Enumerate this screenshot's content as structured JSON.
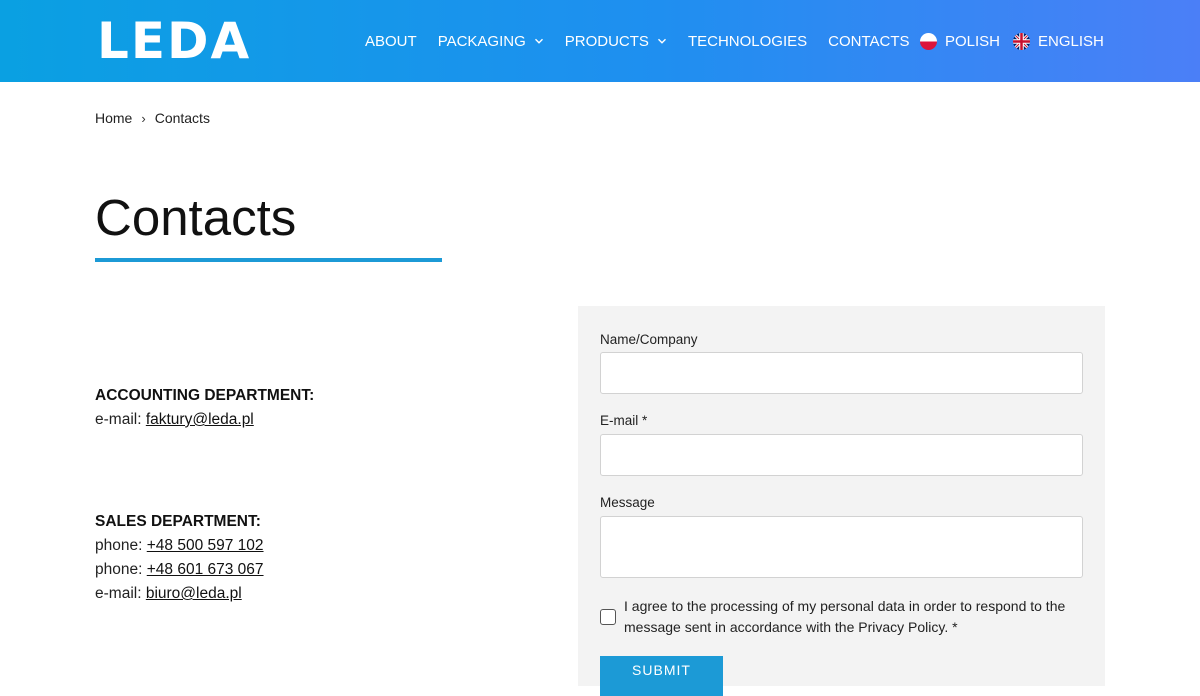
{
  "header": {
    "logo_text": "LEDA",
    "nav": [
      {
        "label": "ABOUT",
        "has_dropdown": false
      },
      {
        "label": "PACKAGING",
        "has_dropdown": true
      },
      {
        "label": "PRODUCTS",
        "has_dropdown": true
      },
      {
        "label": "TECHNOLOGIES",
        "has_dropdown": false
      },
      {
        "label": "CONTACTS",
        "has_dropdown": false
      }
    ],
    "languages": [
      {
        "label": "POLISH",
        "icon": "poland-flag-icon"
      },
      {
        "label": "ENGLISH",
        "icon": "uk-flag-icon"
      }
    ],
    "colors": {
      "gradient_start": "#0aa0e2",
      "gradient_end": "#4b7ff7"
    }
  },
  "breadcrumb": {
    "home": "Home",
    "separator": "›",
    "current": "Contacts"
  },
  "page": {
    "title": "Contacts",
    "accent": "#1c9ad6"
  },
  "departments": {
    "accounting": {
      "title": "ACCOUNTING DEPARTMENT:",
      "email_label": "e-mail:",
      "email": "faktury@leda.pl"
    },
    "sales": {
      "title": "SALES DEPARTMENT:",
      "phone_label": "phone:",
      "phone1": "+48 500 597 102",
      "phone2": "+48 601 673 067",
      "email_label": "e-mail:",
      "email": "biuro@leda.pl"
    }
  },
  "form": {
    "name_label": "Name/Company",
    "email_label": "E-mail *",
    "message_label": "Message",
    "consent_text": "I agree to the processing of my personal data in order to respond to the message sent in accordance with the Privacy Policy. *",
    "submit_label": "SUBMIT"
  }
}
